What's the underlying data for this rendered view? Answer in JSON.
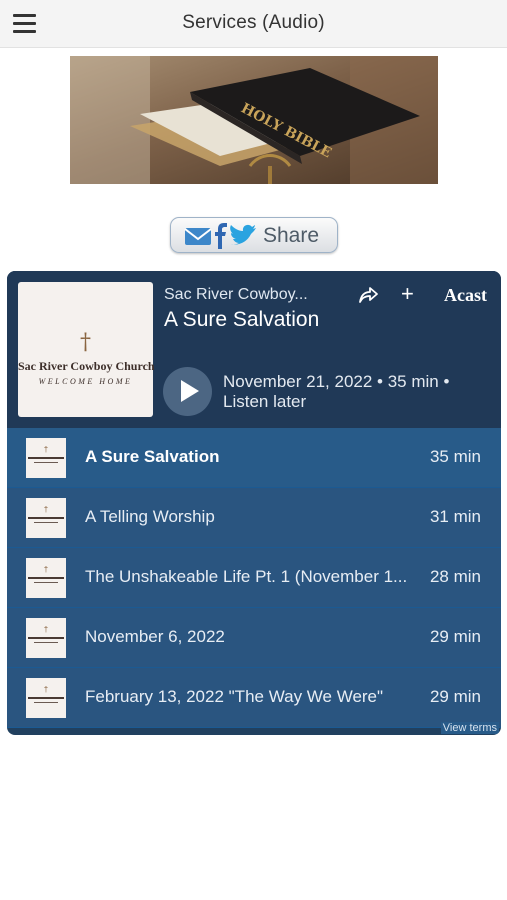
{
  "header": {
    "title": "Services (Audio)",
    "menu_icon": "hamburger-menu-icon"
  },
  "banner": {
    "image": "holy-bible-on-lectern",
    "book_text": "HOLY BIBLE"
  },
  "share": {
    "label": "Share",
    "icons": [
      "email-icon",
      "facebook-icon",
      "twitter-icon"
    ]
  },
  "player": {
    "show_name": "Sac River Cowboy...",
    "episode_title": "A Sure Salvation",
    "provider": "Acast",
    "cover": {
      "cross": "†",
      "title": "Sac River Cowboy Church",
      "subtitle": "WELCOME HOME"
    },
    "meta": "November 21, 2022 • 35 min •",
    "listen_later": "Listen later",
    "colors": {
      "head": "#203957",
      "list": "#2a5580",
      "active": "#285b89"
    }
  },
  "episodes": [
    {
      "title": "A Sure Salvation",
      "duration": "35 min"
    },
    {
      "title": "A Telling Worship",
      "duration": "31 min"
    },
    {
      "title": "The Unshakeable Life Pt. 1 (November 1...",
      "duration": "28 min"
    },
    {
      "title": "November 6, 2022",
      "duration": "29 min"
    },
    {
      "title": "February 13, 2022 \"The Way We Were\"",
      "duration": "29 min"
    }
  ],
  "footer": {
    "view_terms": "View terms"
  }
}
